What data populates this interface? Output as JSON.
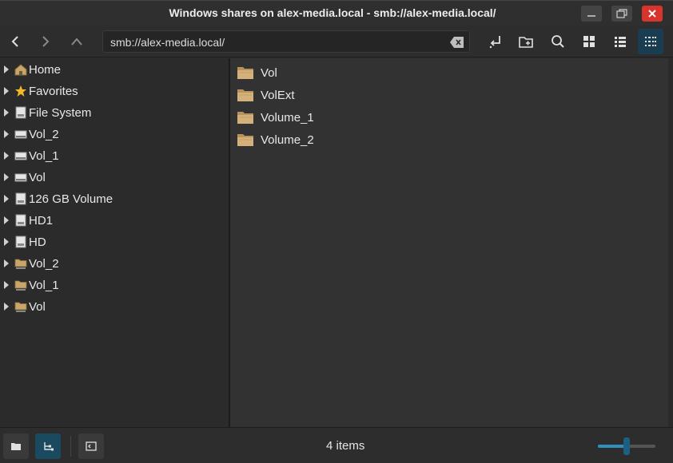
{
  "window": {
    "title": "Windows shares on alex-media.local - smb://alex-media.local/"
  },
  "toolbar": {
    "location": "smb://alex-media.local/"
  },
  "sidebar": {
    "items": [
      {
        "label": "Home",
        "icon": "home-icon"
      },
      {
        "label": "Favorites",
        "icon": "star-icon"
      },
      {
        "label": "File System",
        "icon": "drive-icon"
      },
      {
        "label": "Vol_2",
        "icon": "removable-drive-icon"
      },
      {
        "label": "Vol_1",
        "icon": "removable-drive-icon"
      },
      {
        "label": "Vol",
        "icon": "removable-drive-icon"
      },
      {
        "label": "126 GB Volume",
        "icon": "drive-icon"
      },
      {
        "label": "HD1",
        "icon": "drive-icon"
      },
      {
        "label": "HD",
        "icon": "drive-icon"
      },
      {
        "label": "Vol_2",
        "icon": "network-folder-icon"
      },
      {
        "label": "Vol_1",
        "icon": "network-folder-icon"
      },
      {
        "label": "Vol",
        "icon": "network-folder-icon"
      }
    ]
  },
  "main": {
    "files": [
      {
        "label": "Vol"
      },
      {
        "label": "VolExt"
      },
      {
        "label": "Volume_1"
      },
      {
        "label": "Volume_2"
      }
    ]
  },
  "status": {
    "text": "4 items",
    "zoom_level": 0.5
  },
  "colors": {
    "accent": "#2f8fbf",
    "close": "#d9342b",
    "folder": "#c8a56a"
  }
}
